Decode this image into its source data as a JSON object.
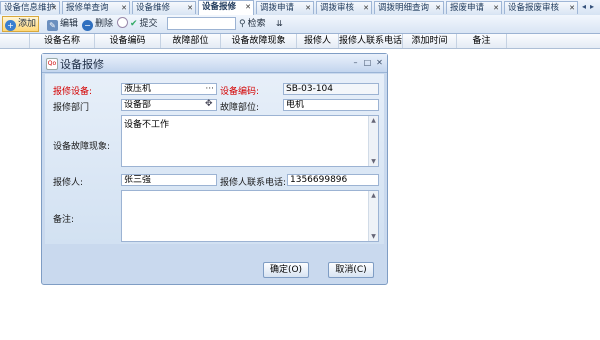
{
  "tabs": [
    {
      "label": "设备信息维护"
    },
    {
      "label": "报修单查询"
    },
    {
      "label": "设备维修"
    },
    {
      "label": "设备报修"
    },
    {
      "label": "调拨申请"
    },
    {
      "label": "调拨审核"
    },
    {
      "label": "调拨明细查询"
    },
    {
      "label": "报废申请"
    },
    {
      "label": "设备报废审核"
    }
  ],
  "toolbar": {
    "add": "添加",
    "edit": "编辑",
    "delete": "删除",
    "submit": "提交",
    "search": "检索",
    "search_value": ""
  },
  "grid": {
    "columns": [
      "设备名称",
      "设备编码",
      "故障部位",
      "设备故障现象",
      "报修人",
      "报修人联系电话",
      "添加时间",
      "备注"
    ]
  },
  "dialog": {
    "title": "设备报修",
    "device_name_label": "报修设备:",
    "device_name": "液压机",
    "device_code_label": "设备编码:",
    "device_code": "SB-03-104",
    "dept_label": "报修部门",
    "dept": "设备部",
    "fault_part_label": "故障部位:",
    "fault_part": "电机",
    "symptom_label": "设备故障现象:",
    "symptom": "设备不工作",
    "reporter_label": "报修人:",
    "reporter": "张三强",
    "phone_label": "报修人联系电话:",
    "phone": "1356699896",
    "note_label": "备注:",
    "note": "",
    "ok_button": "确定(O)",
    "cancel_button": "取消(C)"
  },
  "colors": {
    "required_label": "#d40000",
    "accent": "#7f9dc4"
  }
}
